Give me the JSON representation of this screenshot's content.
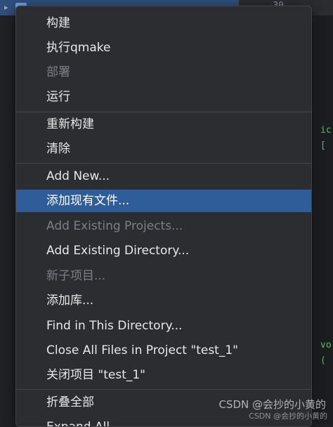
{
  "background": {
    "line_number": "30",
    "right_code_fragments": [
      "ic",
      "[",
      "vo",
      "("
    ]
  },
  "menu": {
    "items": [
      {
        "label": "构建",
        "state": "enabled"
      },
      {
        "label": "执行qmake",
        "state": "enabled"
      },
      {
        "label": "部署",
        "state": "disabled"
      },
      {
        "label": "运行",
        "state": "enabled"
      },
      {
        "label": "重新构建",
        "state": "enabled"
      },
      {
        "label": "清除",
        "state": "enabled"
      },
      {
        "label": "Add New...",
        "state": "enabled"
      },
      {
        "label": "添加现有文件...",
        "state": "selected"
      },
      {
        "label": "Add Existing Projects...",
        "state": "disabled"
      },
      {
        "label": "Add Existing Directory...",
        "state": "enabled"
      },
      {
        "label": "新子项目...",
        "state": "disabled"
      },
      {
        "label": "添加库...",
        "state": "enabled"
      },
      {
        "label": "Find in This Directory...",
        "state": "enabled"
      },
      {
        "label": "Close All Files in Project \"test_1\"",
        "state": "enabled"
      },
      {
        "label": "关闭项目 \"test_1\"",
        "state": "enabled"
      },
      {
        "label": "折叠全部",
        "state": "enabled"
      },
      {
        "label": "Expand All",
        "state": "enabled"
      }
    ]
  },
  "watermark": {
    "text": "CSDN @会抄的小黄的",
    "text_small": "CSDN @会抄的小黄的"
  },
  "colors": {
    "menu_bg": "#2b2d30",
    "selected_bg": "#2f5d9a",
    "text": "#e8e8e8",
    "disabled_text": "#7c7f84"
  }
}
